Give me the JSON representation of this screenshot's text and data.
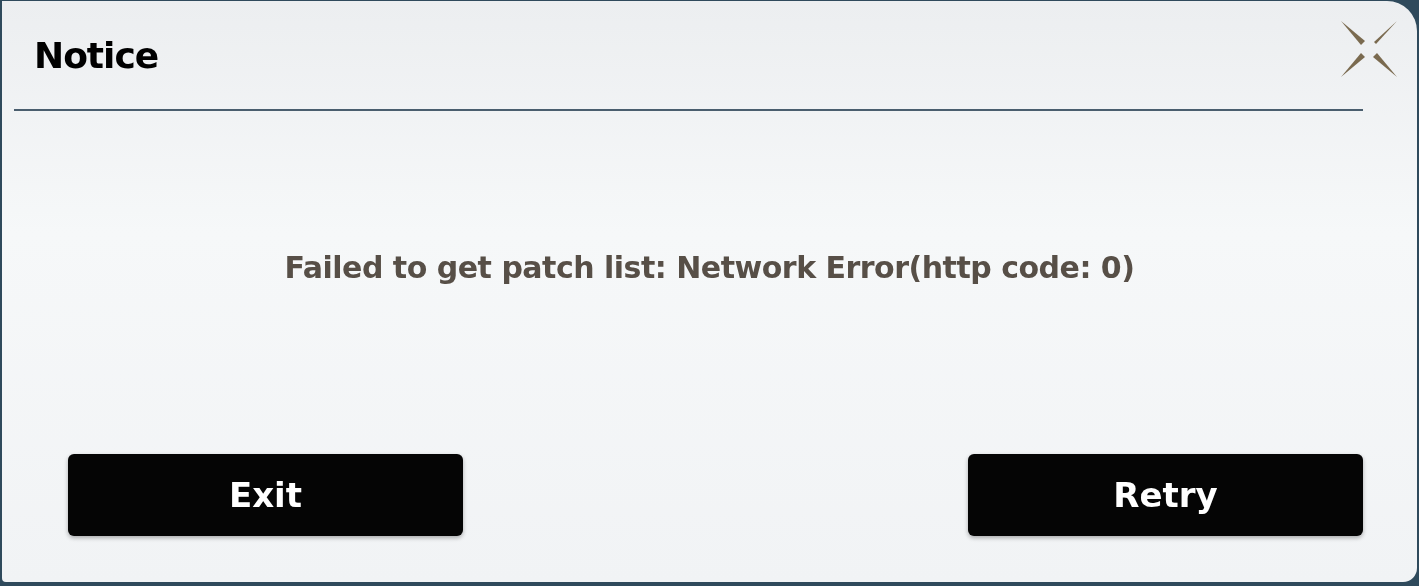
{
  "dialog": {
    "title": "Notice",
    "message": "Failed to get patch list: Network Error(http code: 0)",
    "buttons": [
      {
        "label": "Exit"
      },
      {
        "label": "Retry"
      }
    ]
  }
}
